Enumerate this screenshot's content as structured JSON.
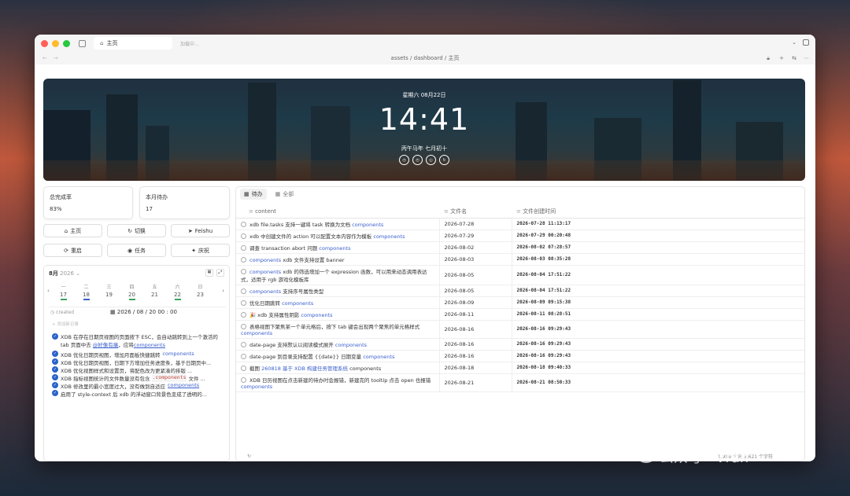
{
  "window": {
    "tab_title": "主页",
    "tab2_title": "加载中...",
    "breadcrumb": "assets / dashboard / 主页"
  },
  "banner": {
    "date": "星期六 08月22日",
    "time": "14:41",
    "lunar": "丙午马年 七月初十"
  },
  "stats": {
    "completion_label": "总完成率",
    "completion_value": "83%",
    "month_todo_label": "本月待办",
    "month_todo_value": "17"
  },
  "buttons": [
    {
      "label": "主页",
      "icon": "home-icon"
    },
    {
      "label": "切换",
      "icon": "refresh-icon"
    },
    {
      "label": "Feishu",
      "icon": "send-icon"
    },
    {
      "label": "重启",
      "icon": "restart-icon"
    },
    {
      "label": "任务",
      "icon": "check-icon"
    },
    {
      "label": "庆祝",
      "icon": "party-icon"
    }
  ],
  "calendar": {
    "month": "8月",
    "year": "2026",
    "days": [
      {
        "w": "一",
        "d": "17",
        "color": "#3aa55a"
      },
      {
        "w": "二",
        "d": "18",
        "color": "#3a5fcd"
      },
      {
        "w": "三",
        "d": "19",
        "color": ""
      },
      {
        "w": "四",
        "d": "20",
        "color": "#3aa55a"
      },
      {
        "w": "五",
        "d": "21",
        "color": ""
      },
      {
        "w": "六",
        "d": "22",
        "color": "#3aa55a"
      },
      {
        "w": "日",
        "d": "23",
        "color": ""
      }
    ],
    "created_label": "created",
    "created_value": "2026 / 08 / 20  00 : 00",
    "add_hint": "添加新记事"
  },
  "tasks": [
    {
      "text": "XDB 在存在日期页视图的页面按下 ESC，会自动跳转到上一个激活的 tab 页面中去 ",
      "link": "@好像有痛",
      "tail": "，应将",
      "link2": "components"
    },
    {
      "text": "XDB 优化日期页视图，增加月面板快捷跳转 ",
      "link": "components",
      "tail": "",
      "link2": ""
    },
    {
      "text": "XDB 优化日期页视图，日期下方增加任务进度条，基于日期页中...",
      "link": "",
      "tail": "",
      "link2": ""
    },
    {
      "text": "XDB 优化视图样式和设置页，将配色改为更紧凑的排版 ...",
      "link": "",
      "tail": "",
      "link2": ""
    },
    {
      "text": "XDB 指标视图统计的文件数量没有包含 ",
      "code": ".components",
      "tail": " 文件 ...",
      "link": "",
      "link2": ""
    },
    {
      "text": "XDB 修改里的最小宽度过大，没有做到自适应 ",
      "link": "components",
      "tail": "",
      "link2": ""
    },
    {
      "text": "启用了 style-context 后 xdb 的浮动窗口背景色变成了透明的...",
      "link": "",
      "tail": "",
      "link2": ""
    }
  ],
  "table": {
    "tabs": [
      "待办",
      "全部"
    ],
    "headers": [
      "content",
      "文件名",
      "文件创建时间"
    ],
    "rows": [
      {
        "pre": "xdb file.tasks 支持一键将 task 转换为文档 ",
        "link": "components",
        "post": "",
        "file": "2026-07-28",
        "time": "2026-07-28 11:13:17"
      },
      {
        "pre": "xdb 中创建文件的 action 可以配置文本内容作为模板 ",
        "link": "components",
        "post": "",
        "file": "2026-07-29",
        "time": "2026-07-29 00:20:48"
      },
      {
        "pre": "调查 transaction abort 问题 ",
        "link": "components",
        "post": "",
        "file": "2026-08-02",
        "time": "2026-08-02 07:28:57"
      },
      {
        "pre": "",
        "link": "components",
        "post": " xdb 文件支持设置 banner",
        "file": "2026-08-03",
        "time": "2026-08-03 08:35:28"
      },
      {
        "pre": "",
        "link": "components",
        "post": " xdb 的筛选增加一个 expression 函数，可以用来动态调用表达式，适用于 rgb 游戏化模板库",
        "file": "2026-08-05",
        "time": "2026-08-04 17:51:22"
      },
      {
        "pre": "",
        "link": "components",
        "post": " 支持序号属性类型",
        "file": "2026-08-05",
        "time": "2026-08-04 17:51:22"
      },
      {
        "pre": "优化日期跳转 ",
        "link": "components",
        "post": "",
        "file": "2026-08-09",
        "time": "2026-08-09 09:15:38"
      },
      {
        "pre": "🎉 xdb 支持属性阴影 ",
        "link": "components",
        "post": "",
        "file": "2026-08-11",
        "time": "2026-08-11 08:28:51"
      },
      {
        "pre": "表格视图下聚焦某一个单元格后，按下 tab 键会出现两个聚焦的单元格样式 ",
        "link": "components",
        "post": "",
        "file": "2026-08-16",
        "time": "2026-08-16 09:29:43"
      },
      {
        "pre": "date-page 支持默认以阅读模式展开 ",
        "link": "components",
        "post": "",
        "file": "2026-08-16",
        "time": "2026-08-16 09:29:43"
      },
      {
        "pre": "date-page 到目录支持配置 {{date}} 日期变量 ",
        "link": "components",
        "post": "",
        "file": "2026-08-16",
        "time": "2026-08-16 09:29:43"
      },
      {
        "pre": "截图 ",
        "link": "260818 基于 XDB 构建任务管理系统",
        "post": " components",
        "file": "2026-08-18",
        "time": "2026-08-18 09:40:33"
      },
      {
        "pre": "XDB 日历视图在点击新建的待办时会报错，新建完的 tooltip 点击 open 也报错 ",
        "link": "components",
        "post": "",
        "file": "2026-08-21",
        "time": "2026-08-21 08:50:33"
      }
    ],
    "footer": "1,999 个词 3,621 个字符"
  },
  "watermark": "公众号 · Vran"
}
